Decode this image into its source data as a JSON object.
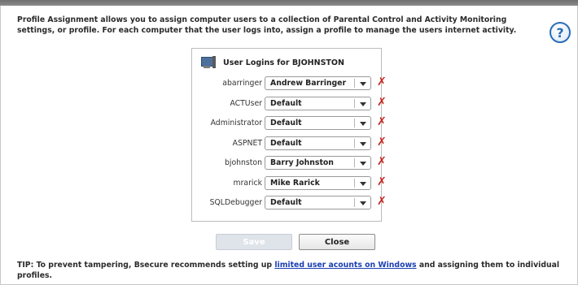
{
  "intro": "Profile Assignment allows you to assign computer users to a collection of Parental Control and Activity Monitoring settings, or profile. For each computer that the user logs into, assign a profile to manage the users internet activity.",
  "help_glyph": "?",
  "box_title": "User Logins for BJOHNSTON",
  "users": [
    {
      "name": "abarringer",
      "profile": "Andrew Barringer"
    },
    {
      "name": "ACTUser",
      "profile": "Default"
    },
    {
      "name": "Administrator",
      "profile": "Default"
    },
    {
      "name": "ASPNET",
      "profile": "Default"
    },
    {
      "name": "bjohnston",
      "profile": "Barry Johnston"
    },
    {
      "name": "mrarick",
      "profile": "Mike Rarick"
    },
    {
      "name": "SQLDebugger",
      "profile": "Default"
    }
  ],
  "delete_glyph": "✗",
  "buttons": {
    "save": "Save",
    "close": "Close"
  },
  "tip": {
    "prefix": "TIP: To prevent tampering, Bsecure recommends setting up ",
    "link": "limited user acounts on Windows",
    "suffix": " and assigning them to individual profiles."
  },
  "colors": {
    "delete": "#c4241b",
    "link": "#1a3fb3",
    "help": "#2a6eb6"
  }
}
